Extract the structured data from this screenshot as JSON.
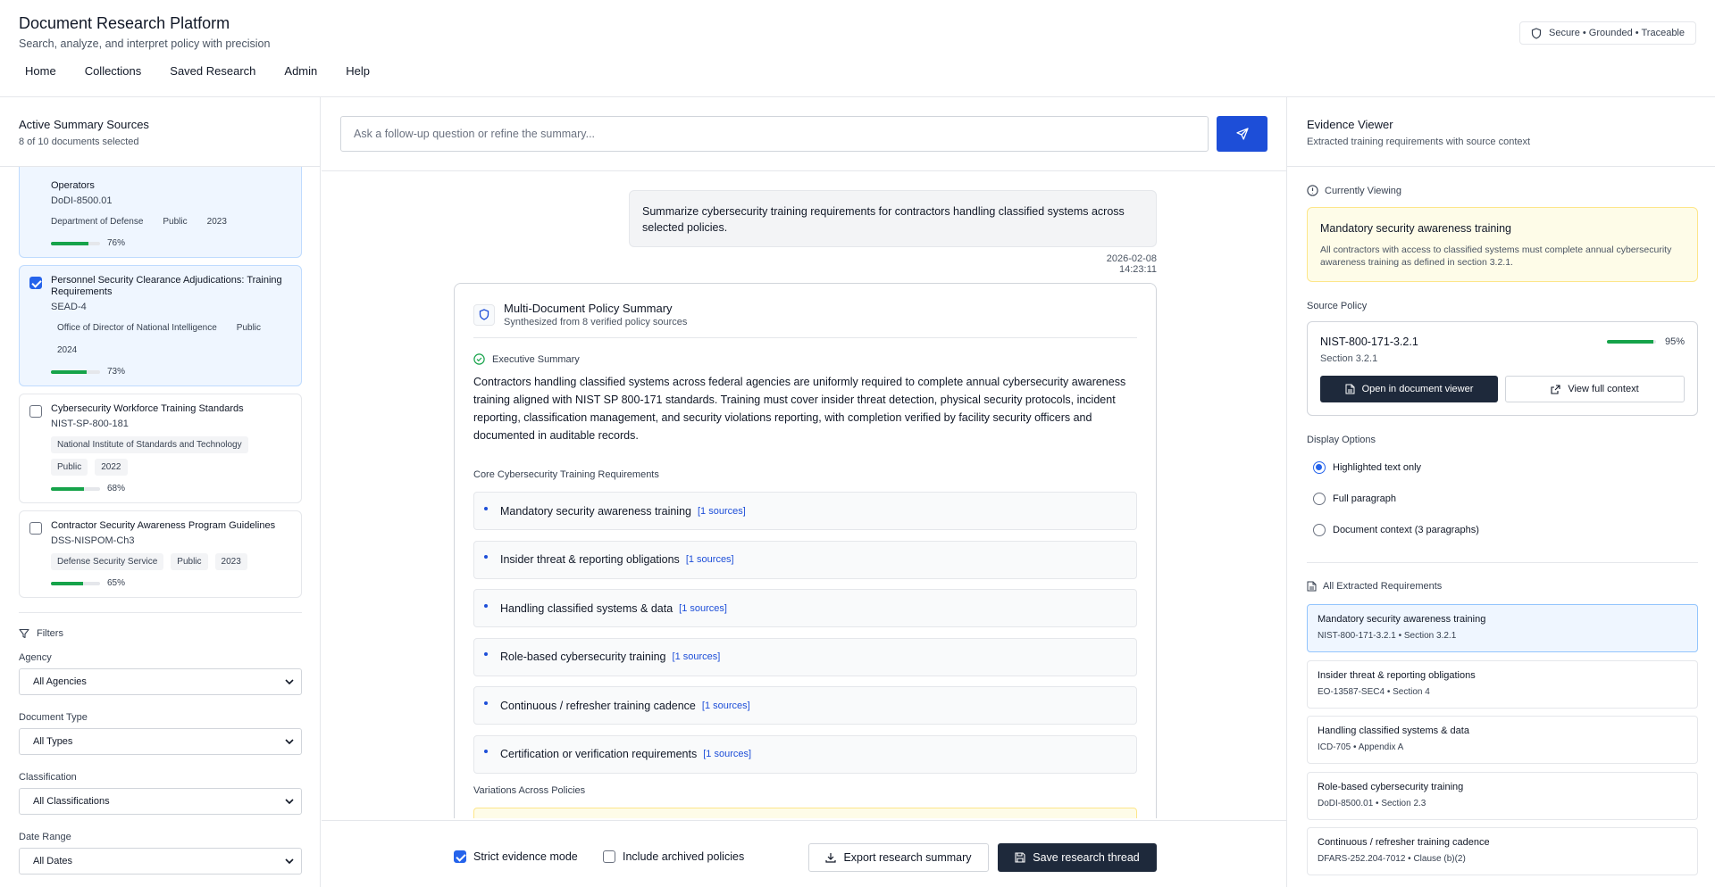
{
  "app": {
    "title": "Document Research Platform",
    "subtitle": "Search, analyze, and interpret policy with precision",
    "badge": "Secure • Grounded • Traceable"
  },
  "nav": [
    "Home",
    "Collections",
    "Saved Research",
    "Admin",
    "Help"
  ],
  "sources": {
    "title": "Active Summary Sources",
    "subtitle": "8 of 10 documents selected",
    "documents": [
      {
        "title": "Operators",
        "code": "DoDI-8500.01",
        "tags": [
          "Department of Defense",
          "Public",
          "2023"
        ],
        "score": 76,
        "score_label": "76%",
        "selected": true
      },
      {
        "title": "Personnel Security Clearance Adjudications: Training Requirements",
        "code": "SEAD-4",
        "tags": [
          "Office of Director of National Intelligence",
          "Public",
          "2024"
        ],
        "score": 73,
        "score_label": "73%",
        "selected": true
      },
      {
        "title": "Cybersecurity Workforce Training Standards",
        "code": "NIST-SP-800-181",
        "tags": [
          "National Institute of Standards and Technology",
          "Public",
          "2022"
        ],
        "score": 68,
        "score_label": "68%",
        "selected": false
      },
      {
        "title": "Contractor Security Awareness Program Guidelines",
        "code": "DSS-NISPOM-Ch3",
        "tags": [
          "Defense Security Service",
          "Public",
          "2023"
        ],
        "score": 65,
        "score_label": "65%",
        "selected": false
      }
    ]
  },
  "filters": {
    "title": "Filters",
    "agency_label": "Agency",
    "agency_value": "All Agencies",
    "doctype_label": "Document Type",
    "doctype_value": "All Types",
    "class_label": "Classification",
    "class_value": "All Classifications",
    "date_label": "Date Range",
    "date_value": "All Dates"
  },
  "chat": {
    "placeholder": "Ask a follow-up question or refine the summary...",
    "user_message": "Summarize cybersecurity training requirements for contractors handling classified systems across selected policies.",
    "timestamp": "2026-02-08 14:23:11"
  },
  "summary": {
    "title": "Multi-Document Policy Summary",
    "subtitle": "Synthesized from 8 verified policy sources",
    "exec_label": "Executive Summary",
    "exec_text": "Contractors handling classified systems across federal agencies are uniformly required to complete annual cybersecurity awareness training aligned with NIST SP 800-171 standards. Training must cover insider threat detection, physical security protocols, incident reporting, classification management, and security violations reporting, with completion verified by facility security officers and documented in auditable records.",
    "core_label": "Core Cybersecurity Training Requirements",
    "requirements": [
      {
        "label": "Mandatory security awareness training",
        "sources": "[1 sources]"
      },
      {
        "label": "Insider threat & reporting obligations",
        "sources": "[1 sources]"
      },
      {
        "label": "Handling classified systems & data",
        "sources": "[1 sources]"
      },
      {
        "label": "Role-based cybersecurity training",
        "sources": "[1 sources]"
      },
      {
        "label": "Continuous / refresher training cadence",
        "sources": "[1 sources]"
      },
      {
        "label": "Certification or verification requirements",
        "sources": "[1 sources]"
      }
    ],
    "variations_label": "Variations Across Policies"
  },
  "footer": {
    "strict_label": "Strict evidence mode",
    "strict_checked": true,
    "archived_label": "Include archived policies",
    "archived_checked": false,
    "export_label": "Export research summary",
    "save_label": "Save research thread"
  },
  "evidence": {
    "title": "Evidence Viewer",
    "subtitle": "Extracted training requirements with source context",
    "current_label": "Currently Viewing",
    "current_title": "Mandatory security awareness training",
    "current_text": "All contractors with access to classified systems must complete annual cybersecurity awareness training as defined in section 3.2.1.",
    "source_label": "Source Policy",
    "source_id": "NIST-800-171-3.2.1",
    "source_section": "Section 3.2.1",
    "source_score": 95,
    "source_score_label": "95%",
    "open_label": "Open in document viewer",
    "context_label": "View full context",
    "display_label": "Display Options",
    "options": [
      "Highlighted text only",
      "Full paragraph",
      "Document context (3 paragraphs)"
    ],
    "selected_option": 0,
    "all_label": "All Extracted Requirements",
    "items": [
      {
        "title": "Mandatory security awareness training",
        "meta": "NIST-800-171-3.2.1 • Section 3.2.1",
        "active": true
      },
      {
        "title": "Insider threat & reporting obligations",
        "meta": "EO-13587-SEC4 • Section 4",
        "active": false
      },
      {
        "title": "Handling classified systems & data",
        "meta": "ICD-705 • Appendix A",
        "active": false
      },
      {
        "title": "Role-based cybersecurity training",
        "meta": "DoDI-8500.01 • Section 2.3",
        "active": false
      },
      {
        "title": "Continuous / refresher training cadence",
        "meta": "DFARS-252.204-7012 • Clause (b)(2)",
        "active": false
      }
    ]
  },
  "colors": {
    "accent": "#1d4ed8",
    "dark_button": "#1e293b",
    "progress": "#16a34a",
    "highlight_bg": "#fefce8",
    "selected_bg": "#eff6ff"
  }
}
